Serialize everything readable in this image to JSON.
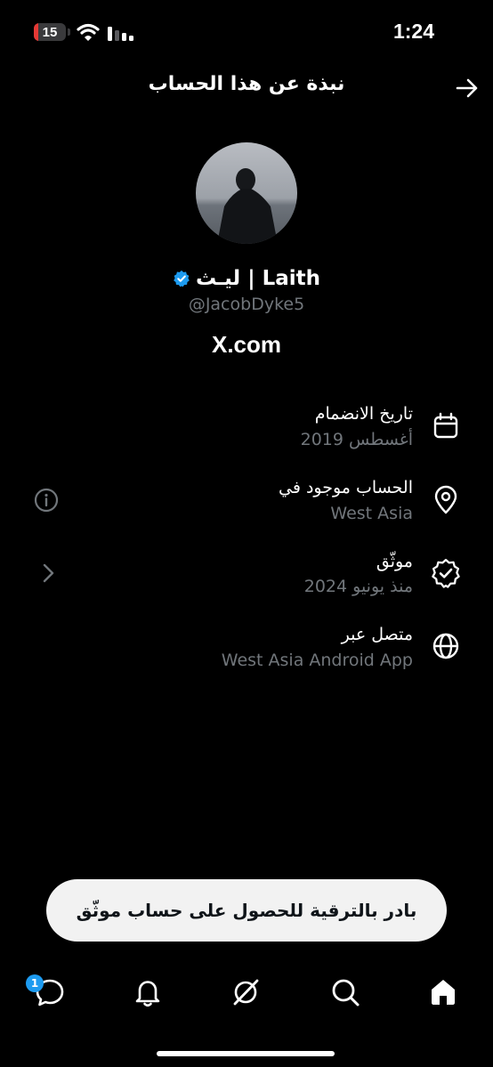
{
  "status_bar": {
    "battery_level": 15,
    "battery_fill_fraction": 0.15,
    "battery_color": "#e53935",
    "time": "1:24",
    "icons": [
      "wifi-icon",
      "cellular-signal-icon"
    ]
  },
  "header": {
    "title": "نبذة عن هذا الحساب",
    "back_icon": "arrow-right-icon"
  },
  "profile": {
    "display_name": "ليـث | Laith",
    "verified": true,
    "verified_color": "#1d9bf0",
    "handle": "@JacobDyke5",
    "site": "X.com"
  },
  "info": {
    "joined": {
      "title": "تاريخ الانضمام",
      "value": "أغسطس 2019",
      "icon": "calendar-icon"
    },
    "location": {
      "title": "الحساب موجود في",
      "value": "West Asia",
      "icon": "location-pin-icon",
      "side_icon": "info-icon"
    },
    "verified": {
      "title": "موثّق",
      "value": "منذ يونيو 2024",
      "icon": "verified-badge-icon",
      "side_icon": "chevron-right-icon"
    },
    "connected_via": {
      "title": "متصل عبر",
      "value": "West Asia Android App",
      "icon": "globe-icon"
    }
  },
  "banner": {
    "label": "بادر بالترقية للحصول على حساب موثّق"
  },
  "nav": {
    "items": [
      "messages-icon",
      "notifications-bell-icon",
      "grok-icon",
      "search-icon",
      "home-icon"
    ],
    "messages_badge": "1",
    "badge_color": "#1d9bf0"
  },
  "colors": {
    "background": "#000000",
    "secondary_text": "#71767b"
  }
}
